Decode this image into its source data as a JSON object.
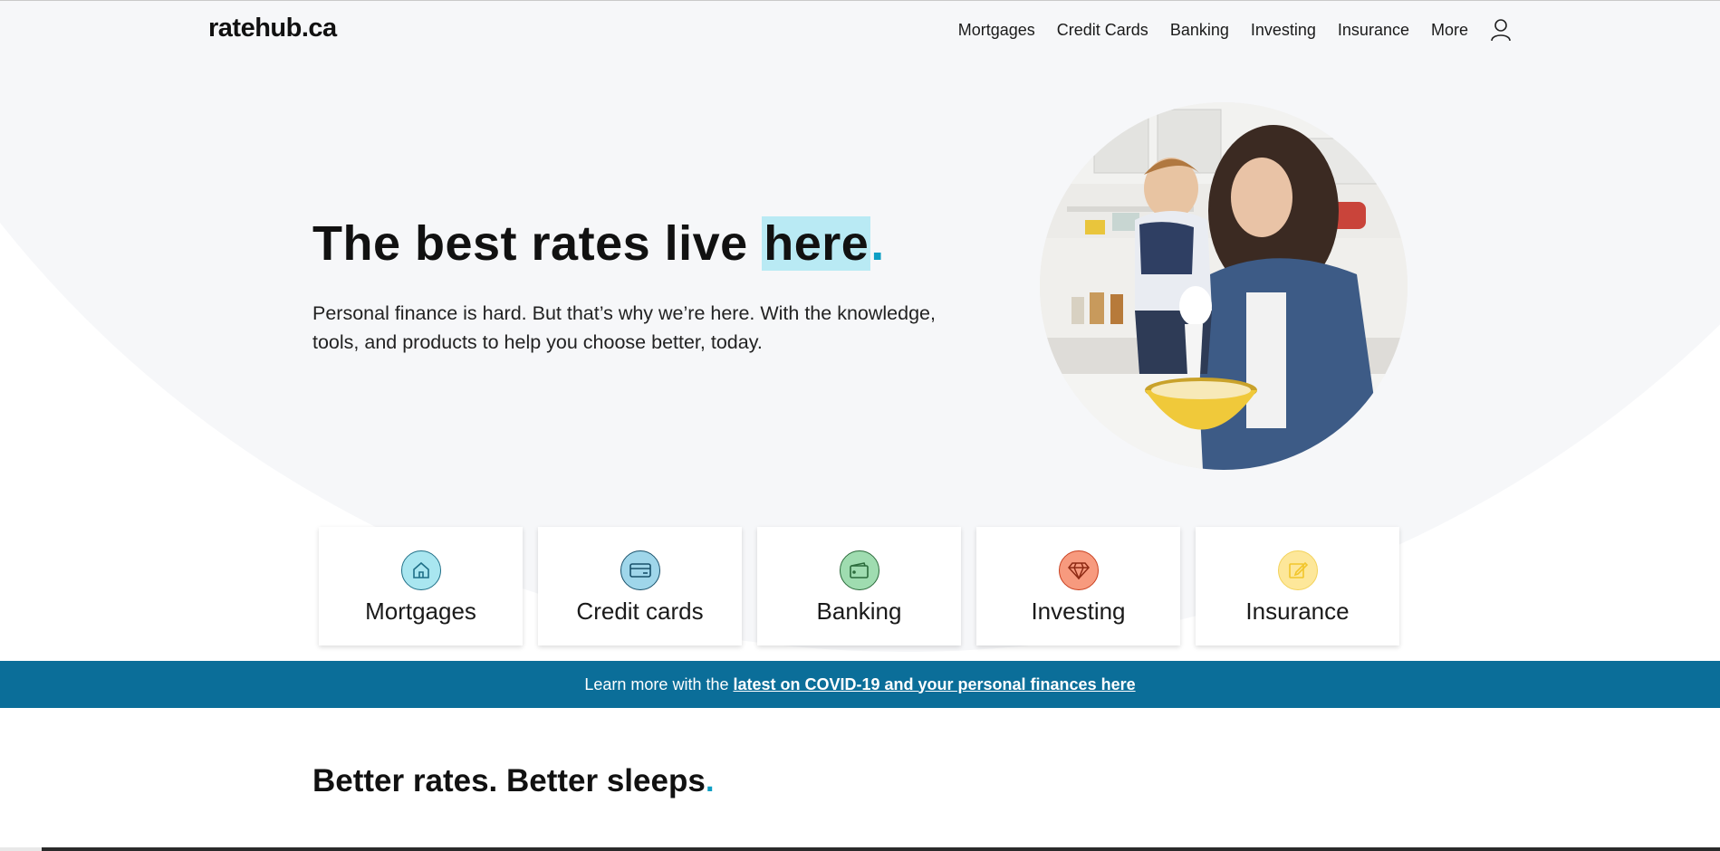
{
  "header": {
    "logo": "ratehub.ca",
    "nav": [
      "Mortgages",
      "Credit Cards",
      "Banking",
      "Investing",
      "Insurance",
      "More"
    ]
  },
  "hero": {
    "headline_pre": "The best rates live ",
    "headline_highlight": "here",
    "headline_dot": ".",
    "subtext": "Personal finance is hard. But that’s why we’re here. With the knowledge, tools, and products to help you choose better, today."
  },
  "categories": [
    {
      "label": "Mortgages",
      "icon": "house-icon",
      "color": "#a9e6f0"
    },
    {
      "label": "Credit cards",
      "icon": "credit-card-icon",
      "color": "#9fd6ea"
    },
    {
      "label": "Banking",
      "icon": "wallet-icon",
      "color": "#9fdcb0"
    },
    {
      "label": "Investing",
      "icon": "diamond-icon",
      "color": "#f79a7e"
    },
    {
      "label": "Insurance",
      "icon": "edit-icon",
      "color": "#fde79a"
    }
  ],
  "banner": {
    "text": "Learn more with the",
    "link": "latest on COVID-19 and your personal finances here"
  },
  "section": {
    "title": "Better rates. Better sleeps",
    "dot": "."
  },
  "colors": {
    "accent": "#0f9fc4",
    "banner": "#0b6e99",
    "highlight": "#b9eaf4",
    "hero_bg": "#f6f7f9"
  }
}
